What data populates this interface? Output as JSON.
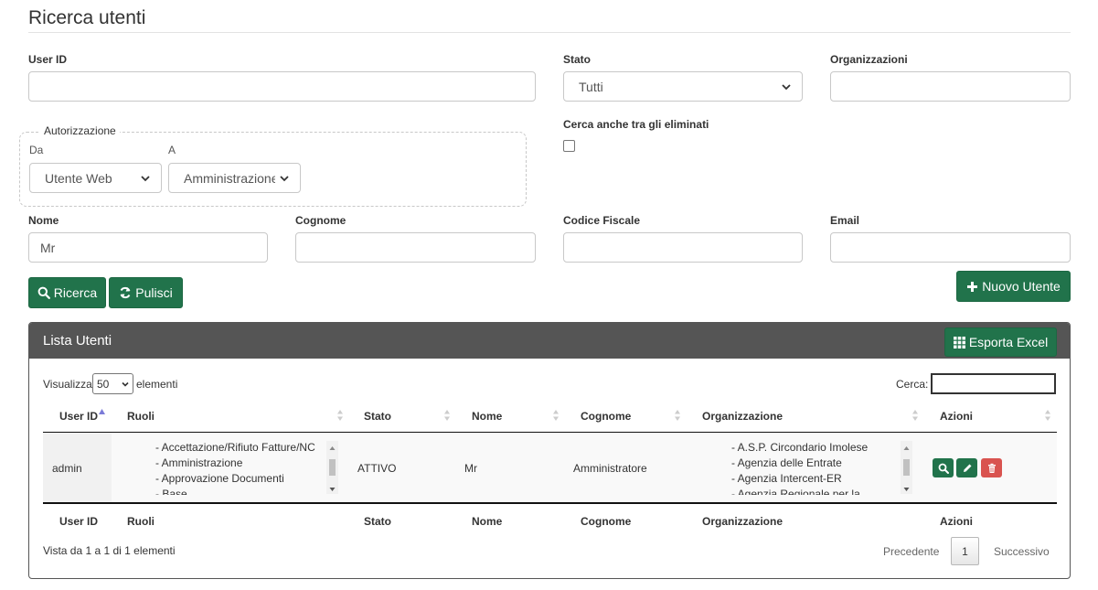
{
  "page": {
    "title": "Ricerca utenti"
  },
  "form": {
    "user_id": {
      "label": "User ID",
      "value": ""
    },
    "stato": {
      "label": "Stato",
      "value": "Tutti"
    },
    "organizzazioni": {
      "label": "Organizzazioni",
      "value": ""
    },
    "autorizzazione": {
      "legend": "Autorizzazione",
      "da_label": "Da",
      "da_value": "Utente Web",
      "a_label": "A",
      "a_value": "Amministrazione"
    },
    "cerca_eliminati": {
      "label": "Cerca anche tra gli eliminati",
      "checked": false
    },
    "nome": {
      "label": "Nome",
      "value": "Mr"
    },
    "cognome": {
      "label": "Cognome",
      "value": ""
    },
    "codice_fiscale": {
      "label": "Codice Fiscale",
      "value": ""
    },
    "email": {
      "label": "Email",
      "value": ""
    }
  },
  "buttons": {
    "ricerca": "Ricerca",
    "pulisci": "Pulisci",
    "nuovo_utente": "Nuovo Utente",
    "esporta_excel": "Esporta Excel"
  },
  "panel": {
    "title": "Lista Utenti",
    "show_prefix": "Visualizza",
    "show_value": "50",
    "show_suffix": "elementi",
    "search_label": "Cerca:",
    "search_value": ""
  },
  "table": {
    "columns": [
      "User ID",
      "Ruoli",
      "Stato",
      "Nome",
      "Cognome",
      "Organizzazione",
      "Azioni"
    ],
    "rows": [
      {
        "user_id": "admin",
        "ruoli": [
          "- Accettazione/Rifiuto Fatture/NC",
          "- Amministrazione",
          "- Approvazione Documenti",
          "- Base"
        ],
        "stato": "ATTIVO",
        "nome": "Mr",
        "cognome": "Amministratore",
        "organizzazione": [
          "- A.S.P. Circondario Imolese",
          "- Agenzia delle Entrate",
          "- Agenzia Intercent-ER",
          "- Agenzia Regionale per la"
        ]
      }
    ]
  },
  "pagination": {
    "info": "Vista da 1 a 1 di 1 elementi",
    "prev": "Precedente",
    "current": "1",
    "next": "Successivo"
  },
  "colors": {
    "green": "#21734b",
    "panel_header": "#555555",
    "danger": "#d9534f",
    "sort_active": "#7b7bd8"
  },
  "icons": [
    "chevron-down-icon",
    "search-icon",
    "refresh-icon",
    "plus-icon",
    "grid-icon",
    "sort-icon",
    "pencil-icon",
    "trash-icon"
  ]
}
